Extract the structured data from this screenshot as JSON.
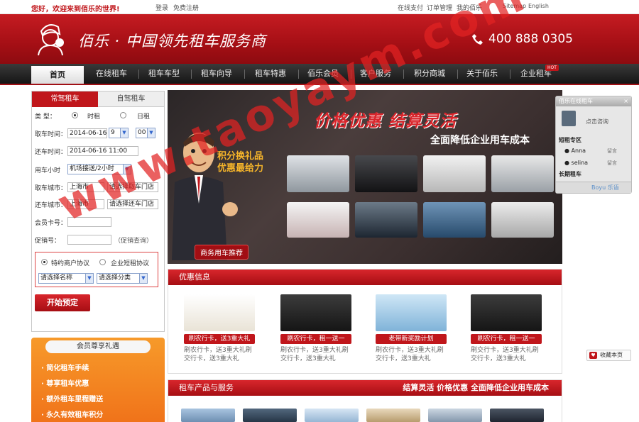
{
  "top": {
    "welcome": "您好，欢迎来到佰乐的世界!",
    "login": "登录",
    "register": "免费注册",
    "links": [
      "在线支付",
      "订单管理",
      "我的佰乐"
    ],
    "sitemap": "Sitemap",
    "english": "English"
  },
  "header": {
    "slogan": "佰乐 · 中国领先租车服务商",
    "phone": "400 888 0305"
  },
  "nav": {
    "items": [
      "首页",
      "在线租车",
      "租车车型",
      "租车向导",
      "租车特惠",
      "佰乐会员",
      "客户服务",
      "积分商城",
      "关于佰乐",
      "企业租车"
    ],
    "hot": "HOT"
  },
  "booking": {
    "tab_daily": "常驾租车",
    "tab_self": "自驾租车",
    "type_label": "类  型：",
    "type_hourly": "时租",
    "type_daily": "日租",
    "pickup_time_label": "取车时间：",
    "pickup_date": "2014-06-16",
    "pickup_hour": "9",
    "pickup_min": "00",
    "return_time_label": "还车时间：",
    "return_time": "2014-06-16 11:00",
    "hours_label": "用车小时",
    "hours_value": "机场接送/2小时",
    "pickup_city_label": "取车城市：",
    "pickup_city": "上海市",
    "pickup_store": "请选择取车门店",
    "return_city_label": "还车城市：",
    "return_city": "上海市",
    "return_store": "请选择还车门店",
    "member_label": "会员卡号：",
    "member_value": "",
    "promo_label": "促销号：",
    "promo_value": "",
    "promo_query": "（促销查询）",
    "agree_special": "特约商户协议",
    "agree_corp": "企业短租协议",
    "select_name": "请选择名称",
    "select_category": "请选择分类",
    "start_button": "开始预定"
  },
  "member": {
    "title": "会员尊享礼遇",
    "items": [
      "简化租车手续",
      "尊享租车优惠",
      "额外租车里程赠送",
      "永久有效租车积分"
    ]
  },
  "banner": {
    "headline": "价格优惠  结算灵活",
    "subheadline": "全面降低企业用车成本",
    "promo_line1": "积分换礼品",
    "promo_line2": "优惠最给力",
    "business": "商务用车推荐"
  },
  "offers": {
    "title": "优惠信息",
    "cards": [
      {
        "caption": "刷农行卡，送3重大礼",
        "text": "刷农行卡，送3重大礼刷交行卡，送3重大礼"
      },
      {
        "caption": "刷农行卡，租一送一",
        "text": "刷农行卡，送3重大礼刷交行卡，送3重大礼"
      },
      {
        "caption": "老带新奖励计划",
        "text": "刷农行卡，送3重大礼刷交行卡，送3重大礼"
      },
      {
        "caption": "刷农行卡，租一送一",
        "text": "刷交行卡，送3重大礼刷交行卡，送3重大礼"
      }
    ]
  },
  "products": {
    "title": "租车产品与服务",
    "tagline": "结算灵活  价格优惠  全面降低企业用车成本"
  },
  "chat": {
    "title": "佰乐在线租车",
    "consult": "点击咨询",
    "short": "短租专区",
    "agents": [
      "Anna",
      "selina"
    ],
    "leave_msg": "留言",
    "long": "长期租车",
    "brand": "Boyu 乐语"
  },
  "favorite": "收藏本页",
  "watermark": "www.taoyaym.com",
  "colors": {
    "brand_red": "#c0161b",
    "orange": "#f08a22"
  }
}
